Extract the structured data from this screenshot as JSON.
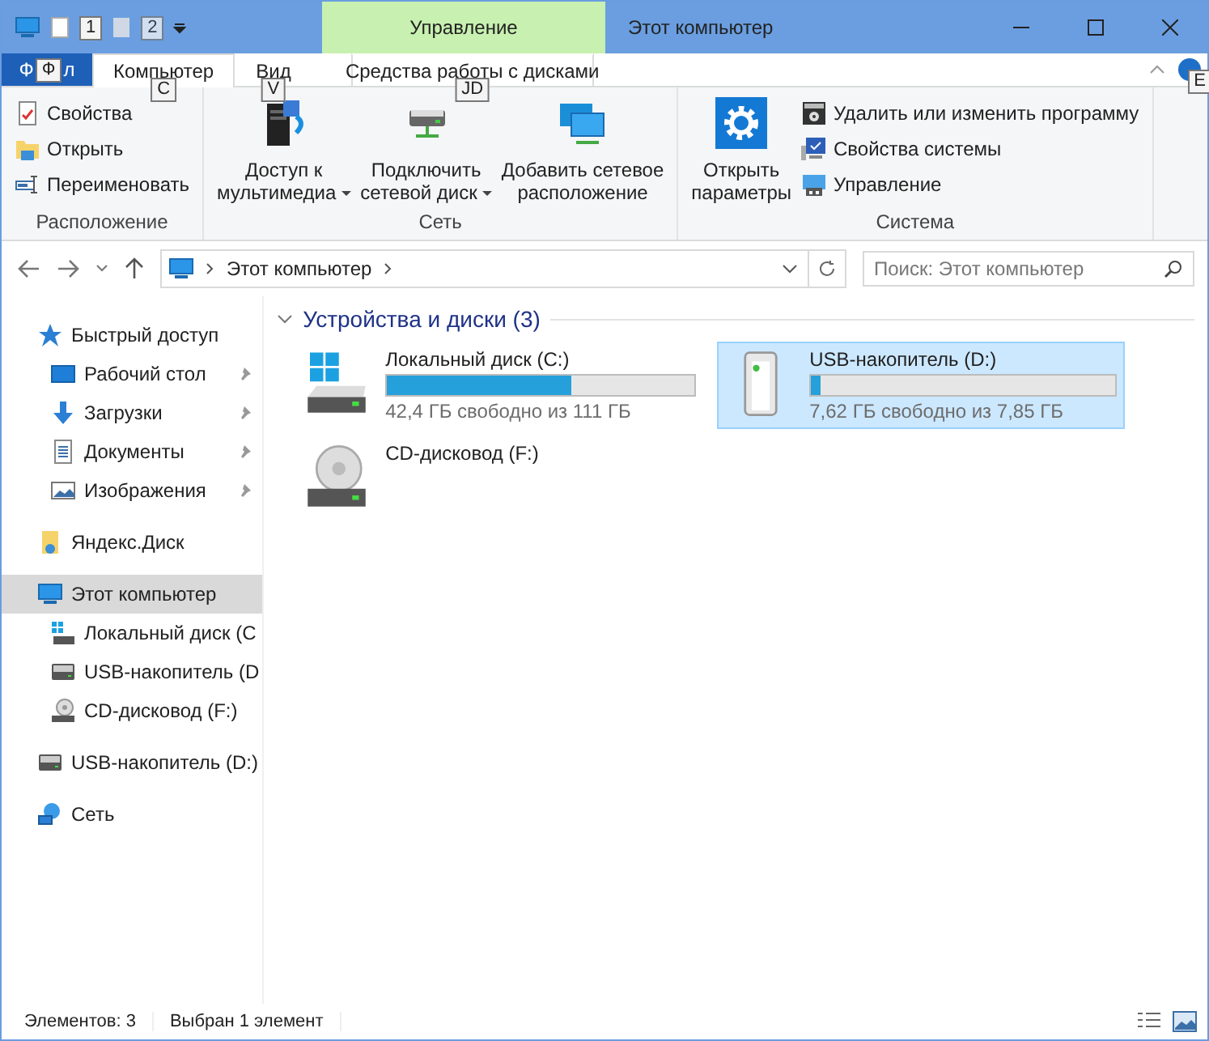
{
  "window": {
    "title": "Этот компьютер",
    "context_group": "Управление"
  },
  "quick_access": {
    "keytips": [
      "1",
      "2"
    ]
  },
  "file_tab": {
    "label_start": "Ф",
    "keytip": "Ф",
    "label_end": "л"
  },
  "tabs": [
    {
      "label": "Компьютер",
      "keytip": "C",
      "selected": true
    },
    {
      "label": "Вид",
      "keytip": "V",
      "selected": false
    },
    {
      "label": "Средства работы с дисками",
      "keytip": "JD",
      "selected": false
    }
  ],
  "help_keytip": "E",
  "ribbon_groups": [
    {
      "label": "Расположение",
      "items": [
        {
          "kind": "small",
          "label": "Свойства"
        },
        {
          "kind": "small",
          "label": "Открыть"
        },
        {
          "kind": "small",
          "label": "Переименовать"
        }
      ]
    },
    {
      "label": "Сеть",
      "items": [
        {
          "kind": "large",
          "lines": [
            "Доступ к",
            "мультимедиа"
          ],
          "dropdown": true
        },
        {
          "kind": "large",
          "lines": [
            "Подключить",
            "сетевой диск"
          ],
          "dropdown": true
        },
        {
          "kind": "large",
          "lines": [
            "Добавить сетевое",
            "расположение"
          ],
          "dropdown": false
        }
      ]
    },
    {
      "label": "Система",
      "items": [
        {
          "kind": "large",
          "lines": [
            "Открыть",
            "параметры"
          ],
          "dropdown": false
        },
        {
          "kind": "small",
          "label": "Удалить или изменить программу"
        },
        {
          "kind": "small",
          "label": "Свойства системы"
        },
        {
          "kind": "small",
          "label": "Управление"
        }
      ]
    }
  ],
  "address": {
    "path": "Этот компьютер"
  },
  "search": {
    "placeholder": "Поиск: Этот компьютер"
  },
  "nav": [
    {
      "label": "Быстрый доступ",
      "selected": false,
      "children": [
        {
          "label": "Рабочий стол",
          "pinned": true,
          "selected": false
        },
        {
          "label": "Загрузки",
          "pinned": true,
          "selected": false
        },
        {
          "label": "Документы",
          "pinned": true,
          "selected": false
        },
        {
          "label": "Изображения",
          "pinned": true,
          "selected": false
        }
      ]
    },
    {
      "label": "Яндекс.Диск",
      "selected": false
    },
    {
      "label": "Этот компьютер",
      "selected": true,
      "children": [
        {
          "label": "Локальный диск (C",
          "selected": false
        },
        {
          "label": "USB-накопитель (D",
          "selected": false
        },
        {
          "label": "CD-дисковод (F:)",
          "selected": false
        }
      ]
    },
    {
      "label": "USB-накопитель (D:)",
      "selected": false
    },
    {
      "label": "Сеть",
      "selected": false
    }
  ],
  "group": {
    "title": "Устройства и диски (3)",
    "expanded": true
  },
  "drives": [
    {
      "name": "Локальный диск (C:)",
      "level": 0.6,
      "free": "42,4 ГБ свободно из 111 ГБ",
      "selected": false
    },
    {
      "name": "USB-накопитель (D:)",
      "level": 0.03,
      "free": "7,62 ГБ свободно из 7,85 ГБ",
      "selected": true
    },
    {
      "name": "CD-дисковод (F:)",
      "selected": false
    }
  ],
  "status": {
    "count": "Элементов: 3",
    "selection": "Выбран 1 элемент"
  }
}
